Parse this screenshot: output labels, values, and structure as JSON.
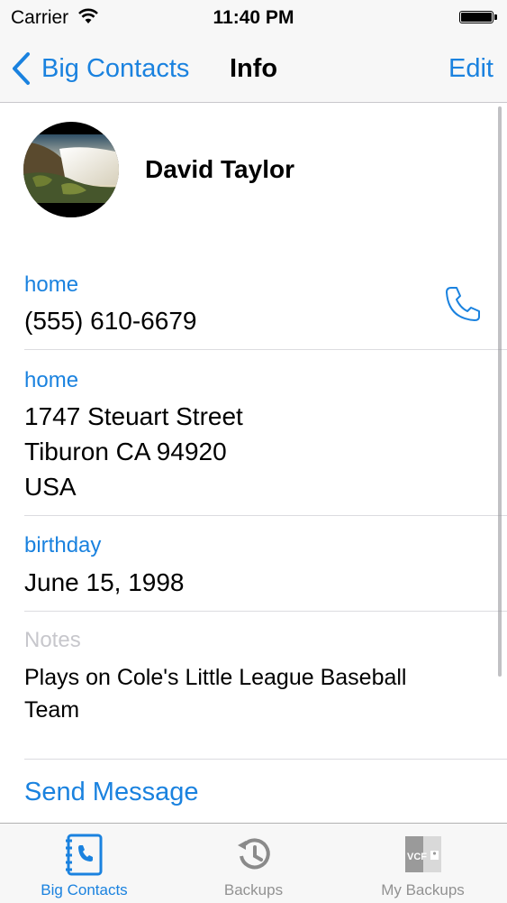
{
  "status_bar": {
    "carrier": "Carrier",
    "time": "11:40 PM"
  },
  "nav": {
    "back_label": "Big Contacts",
    "title": "Info",
    "edit_label": "Edit"
  },
  "contact": {
    "name": "David Taylor",
    "phone": {
      "label": "home",
      "value": "(555) 610-6679"
    },
    "address": {
      "label": "home",
      "street": "1747 Steuart Street",
      "city_line": "Tiburon CA 94920",
      "country": "USA"
    },
    "birthday": {
      "label": "birthday",
      "value": "June 15, 1998"
    },
    "notes": {
      "label": "Notes",
      "value": "Plays on Cole's Little League Baseball Team"
    },
    "send_message_label": "Send Message"
  },
  "tabbar": {
    "tabs": [
      {
        "label": "Big Contacts",
        "icon": "contacts-book-icon",
        "active": true
      },
      {
        "label": "Backups",
        "icon": "history-clock-icon",
        "active": false
      },
      {
        "label": "My Backups",
        "icon": "vcf-file-icon",
        "active": false
      }
    ]
  },
  "colors": {
    "accent": "#1a82df",
    "inactive_tab": "#929292",
    "notes_label": "#c7c7cc",
    "bar_background": "#f7f7f7"
  }
}
